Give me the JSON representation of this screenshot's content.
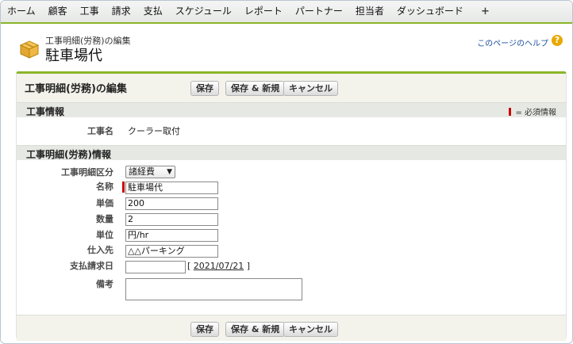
{
  "tabs": [
    "ホーム",
    "顧客",
    "工事",
    "請求",
    "支払",
    "スケジュール",
    "レポート",
    "パートナー",
    "担当者",
    "ダッシュボード",
    "+"
  ],
  "header": {
    "subtitle": "工事明細(労務)の編集",
    "title": "駐車場代",
    "help_link": "このページのヘルプ",
    "help_icon": "?"
  },
  "panel": {
    "title": "工事明細(労務)の編集",
    "save": "保存",
    "save_new": "保存 & 新規",
    "cancel": "キャンセル"
  },
  "section_info": {
    "title": "工事情報",
    "required_legend": "= 必須情報",
    "job_name_label": "工事名",
    "job_name_value": "クーラー取付"
  },
  "section_detail": {
    "title": "工事明細(労務)情報",
    "category_label": "工事明細区分",
    "category_value": "諸経費",
    "name_label": "名称",
    "name_value": "駐車場代",
    "unit_price_label": "単価",
    "unit_price_value": "200",
    "quantity_label": "数量",
    "quantity_value": "2",
    "unit_label": "単位",
    "unit_value": "円/hr",
    "supplier_label": "仕入先",
    "supplier_value": "△△パーキング",
    "pay_date_label": "支払請求日",
    "pay_date_value": "",
    "pay_date_bracket_open": "[",
    "pay_date_today": "2021/07/21",
    "pay_date_bracket_close": "]",
    "notes_label": "備考",
    "notes_value": ""
  }
}
